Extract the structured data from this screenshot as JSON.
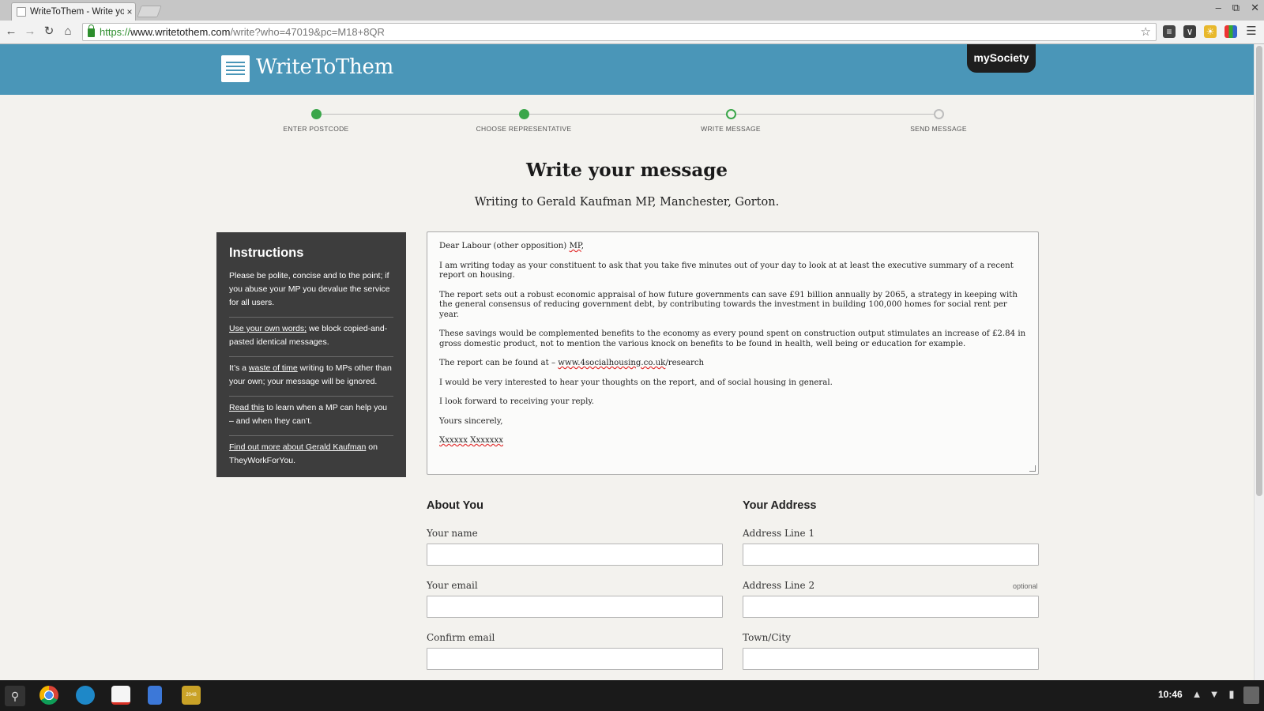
{
  "browser": {
    "tab_title": "WriteToThem - Write yo",
    "tab_close": "×",
    "url_https": "https://",
    "url_host": "www.writetothem.com",
    "url_path": "/write?who=47019&pc=M18+8QR"
  },
  "header": {
    "logo_text": "WriteToThem",
    "partner_badge": "mySociety"
  },
  "stepper": {
    "steps": [
      {
        "label": "ENTER POSTCODE",
        "state": "done"
      },
      {
        "label": "CHOOSE REPRESENTATIVE",
        "state": "done"
      },
      {
        "label": "WRITE MESSAGE",
        "state": "current"
      },
      {
        "label": "SEND MESSAGE",
        "state": "pending"
      }
    ],
    "colors": {
      "done": "#3aa64a",
      "pending": "#bdbdbd"
    }
  },
  "page": {
    "title": "Write your message",
    "subtitle": "Writing to Gerald Kaufman MP, Manchester, Gorton."
  },
  "instructions": {
    "title": "Instructions",
    "items": {
      "i1": "Please be polite, concise and to the point; if you abuse your MP you devalue the service for all users.",
      "i2_link": "Use your own words;",
      "i2_rest": " we block copied-and-pasted identical messages.",
      "i3_pre": "It’s a ",
      "i3_link": "waste of time",
      "i3_rest": " writing to MPs other than your own; your message will be ignored.",
      "i4_link": "Read this",
      "i4_rest": " to learn when a MP can help you – and when they can’t.",
      "i5_link": "Find out more about Gerald Kaufman",
      "i5_rest": " on TheyWorkForYou."
    }
  },
  "message": {
    "greeting_pre": "Dear Labour (other opposition) ",
    "greeting_mp": "MP",
    "greeting_post": ",",
    "p1": "I am writing today as your constituent to ask that you take five minutes out of your day to look at at least the executive summary of a recent report on housing.",
    "p2": "The report sets out a robust economic appraisal of how future governments can save £91 billion annually by 2065, a strategy in keeping with the general consensus of reducing government debt, by contributing towards the investment in building 100,000 homes for social rent per year.",
    "p3": "These savings would be complemented benefits to the economy as every pound spent on construction output stimulates an increase of £2.84 in gross domestic product, not to mention the various knock on benefits to be found in health, well being or education for example.",
    "p4_pre": "The report can be found at – ",
    "p4_link": "www.4socialhousing.co.uk",
    "p4_post": "/research",
    "p5": "I would be very interested to hear your thoughts on the report, and of social housing in general.",
    "p6": "I look forward to receiving your reply.",
    "closing": "Yours sincerely,",
    "signature": "Xxxxxx Xxxxxxx"
  },
  "form": {
    "about_title": "About You",
    "address_title": "Your Address",
    "name_label": "Your name",
    "name_value": "",
    "email_label": "Your email",
    "email_value": "",
    "confirm_label": "Confirm email",
    "confirm_value": "",
    "addr1_label": "Address Line 1",
    "addr1_value": "",
    "addr2_label": "Address Line 2",
    "addr2_optional": "optional",
    "addr2_value": "",
    "town_label": "Town/City",
    "town_value": ""
  },
  "taskbar": {
    "clock": "10:46",
    "apps": [
      "chrome-icon",
      "files-icon",
      "gmail-icon",
      "docs-icon",
      "2048-icon"
    ],
    "app_2048_label": "2048"
  },
  "colors": {
    "header_bg": "#4a96b8",
    "page_bg": "#f3f2ee",
    "instructions_bg": "#3d3d3d",
    "step_done": "#3aa64a"
  }
}
